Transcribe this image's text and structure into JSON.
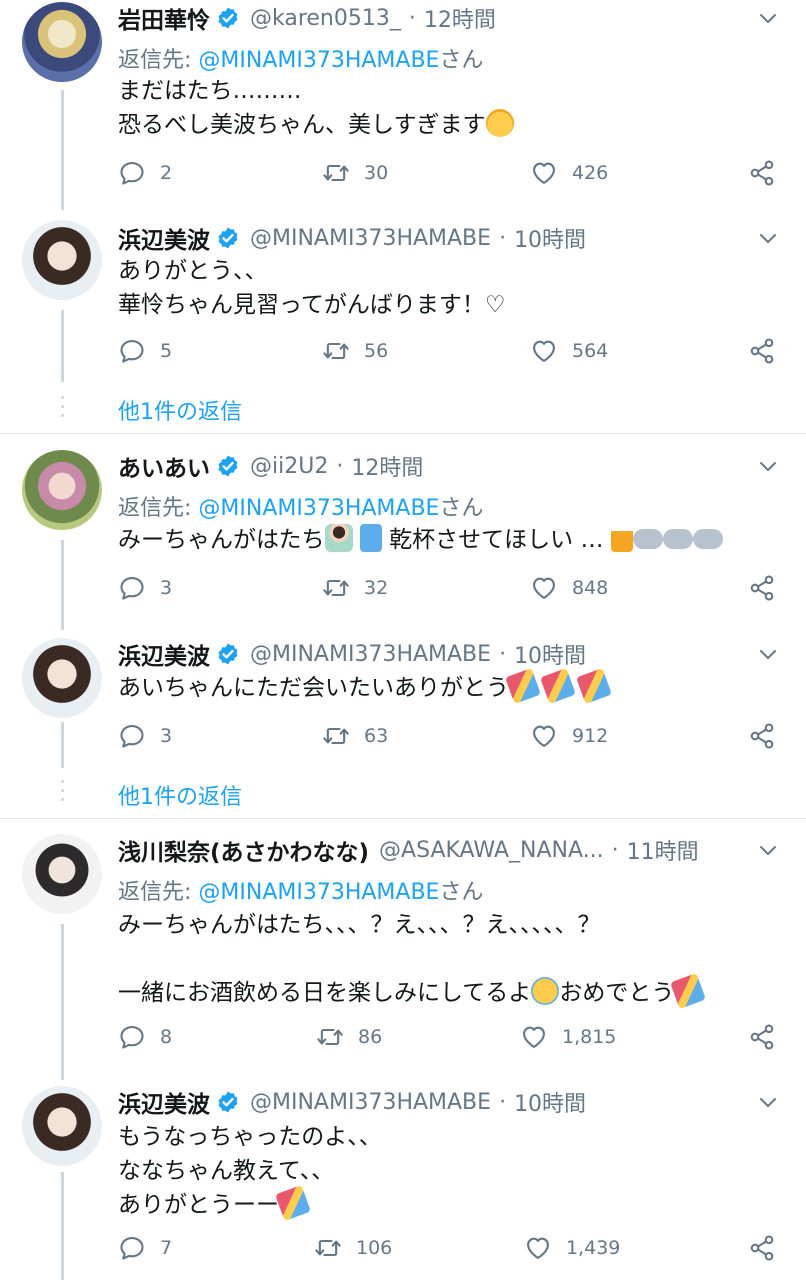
{
  "colors": {
    "link": "#1da1f2",
    "muted": "#657786",
    "text": "#14171a",
    "verified": "#1da1f2",
    "line": "#ccd6dd"
  },
  "tweets": [
    {
      "name": "岩田華怜",
      "handle": "@karen0513_",
      "time": "12時間",
      "reply_prefix": "返信先: ",
      "reply_user": "@MINAMI373HAMABE",
      "reply_suffix": "さん",
      "lines": [
        "まだはたち………",
        "恐るべし美波ちゃん、美しすぎます"
      ],
      "replies": "2",
      "retweets": "30",
      "likes": "426"
    },
    {
      "name": "浜辺美波",
      "handle": "@MINAMI373HAMABE",
      "time": "10時間",
      "lines": [
        "ありがとう、、",
        "華怜ちゃん見習ってがんばります！♡"
      ],
      "replies": "5",
      "retweets": "56",
      "likes": "564"
    },
    {
      "name": "あいあい",
      "handle": "@ii2U2",
      "time": "12時間",
      "reply_prefix": "返信先: ",
      "reply_user": "@MINAMI373HAMABE",
      "reply_suffix": "さん",
      "lines": [
        "みーちゃんがはたち",
        "乾杯させてほしい …"
      ],
      "replies": "3",
      "retweets": "32",
      "likes": "848"
    },
    {
      "name": "浜辺美波",
      "handle": "@MINAMI373HAMABE",
      "time": "10時間",
      "lines": [
        "あいちゃんにただ会いたいありがとう"
      ],
      "replies": "3",
      "retweets": "63",
      "likes": "912"
    },
    {
      "name": "浅川梨奈(あさかわなな)",
      "handle": "@ASAKAWA_NANA...",
      "time": "11時間",
      "reply_prefix": "返信先: ",
      "reply_user": "@MINAMI373HAMABE",
      "reply_suffix": "さん",
      "lines": [
        "みーちゃんがはたち、、、？え、、、？え、、、、、？",
        "一緒にお酒飲める日を楽しみにしてるよ",
        "おめでとう"
      ],
      "replies": "8",
      "retweets": "86",
      "likes": "1,815"
    },
    {
      "name": "浜辺美波",
      "handle": "@MINAMI373HAMABE",
      "time": "10時間",
      "lines": [
        "もうなっちゃったのよ、、",
        "ななちゃん教えて、、",
        "ありがとうーー"
      ],
      "replies": "7",
      "retweets": "106",
      "likes": "1,439"
    }
  ],
  "more_replies": [
    "他1件の返信",
    "他1件の返信"
  ],
  "icons": [
    "verified-badge-icon",
    "chevron-down-icon",
    "reply-icon",
    "retweet-icon",
    "like-icon",
    "share-icon"
  ]
}
